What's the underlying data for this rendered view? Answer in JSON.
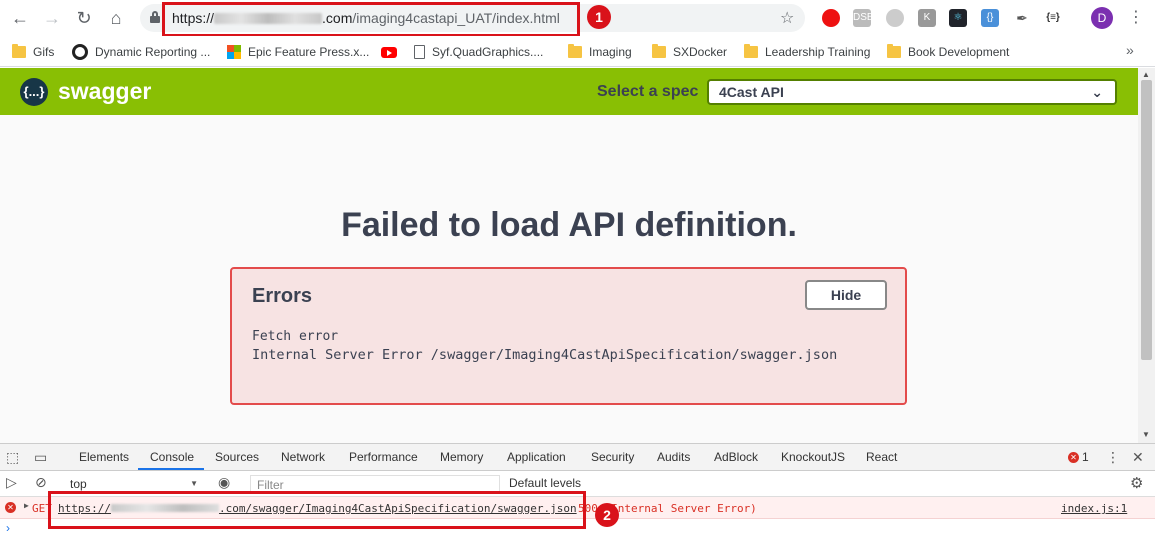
{
  "browser": {
    "url_scheme": "https://",
    "url_host_tail": ".com",
    "url_path": "/imaging4castapi_UAT/index.html",
    "profile_initial": "D",
    "callout_1": "1",
    "callout_2": "2",
    "extensions": [
      "stop-icon",
      "dsb-icon",
      "circle-icon",
      "k-icon",
      "react-icon",
      "json-icon",
      "eyedropper-icon",
      "braces-icon"
    ]
  },
  "bookmarks": [
    {
      "label": "Gifs",
      "icon": "folder-icon"
    },
    {
      "label": "Dynamic Reporting ...",
      "icon": "dr-icon"
    },
    {
      "label": "Epic Feature Press.x...",
      "icon": "microsoft-icon"
    },
    {
      "label": "",
      "icon": "youtube-icon"
    },
    {
      "label": "Syf.QuadGraphics....",
      "icon": "doc-icon"
    },
    {
      "label": "Imaging",
      "icon": "folder-icon"
    },
    {
      "label": "SXDocker",
      "icon": "folder-icon"
    },
    {
      "label": "Leadership Training",
      "icon": "folder-icon"
    },
    {
      "label": "Book Development",
      "icon": "folder-icon"
    }
  ],
  "swagger": {
    "logo_text": "{...}",
    "title": "swagger",
    "spec_label": "Select a spec",
    "spec_value": "4Cast API",
    "fail_title": "Failed to load API definition.",
    "errors_title": "Errors",
    "hide_label": "Hide",
    "error_line1": "Fetch error",
    "error_line2": "Internal Server Error /swagger/Imaging4CastApiSpecification/swagger.json"
  },
  "devtools": {
    "tabs": [
      "Elements",
      "Console",
      "Sources",
      "Network",
      "Performance",
      "Memory",
      "Application",
      "Security",
      "Audits",
      "AdBlock",
      "KnockoutJS",
      "React"
    ],
    "active_tab": "Console",
    "error_count": "1",
    "context": "top",
    "filter_placeholder": "Filter",
    "levels": "Default levels",
    "log": {
      "method": "GET",
      "url_scheme": "https://",
      "url_tail": ".com/swagger/Imaging4CastApiSpecification/swagger.json",
      "status": "500 (Internal Server Error)",
      "source": "index.js:1"
    },
    "prompt": "›"
  },
  "colors": {
    "swagger_green": "#89bf04",
    "swagger_dark": "#3b4151",
    "error_red": "#d93025",
    "callout_red": "#d9121a"
  }
}
